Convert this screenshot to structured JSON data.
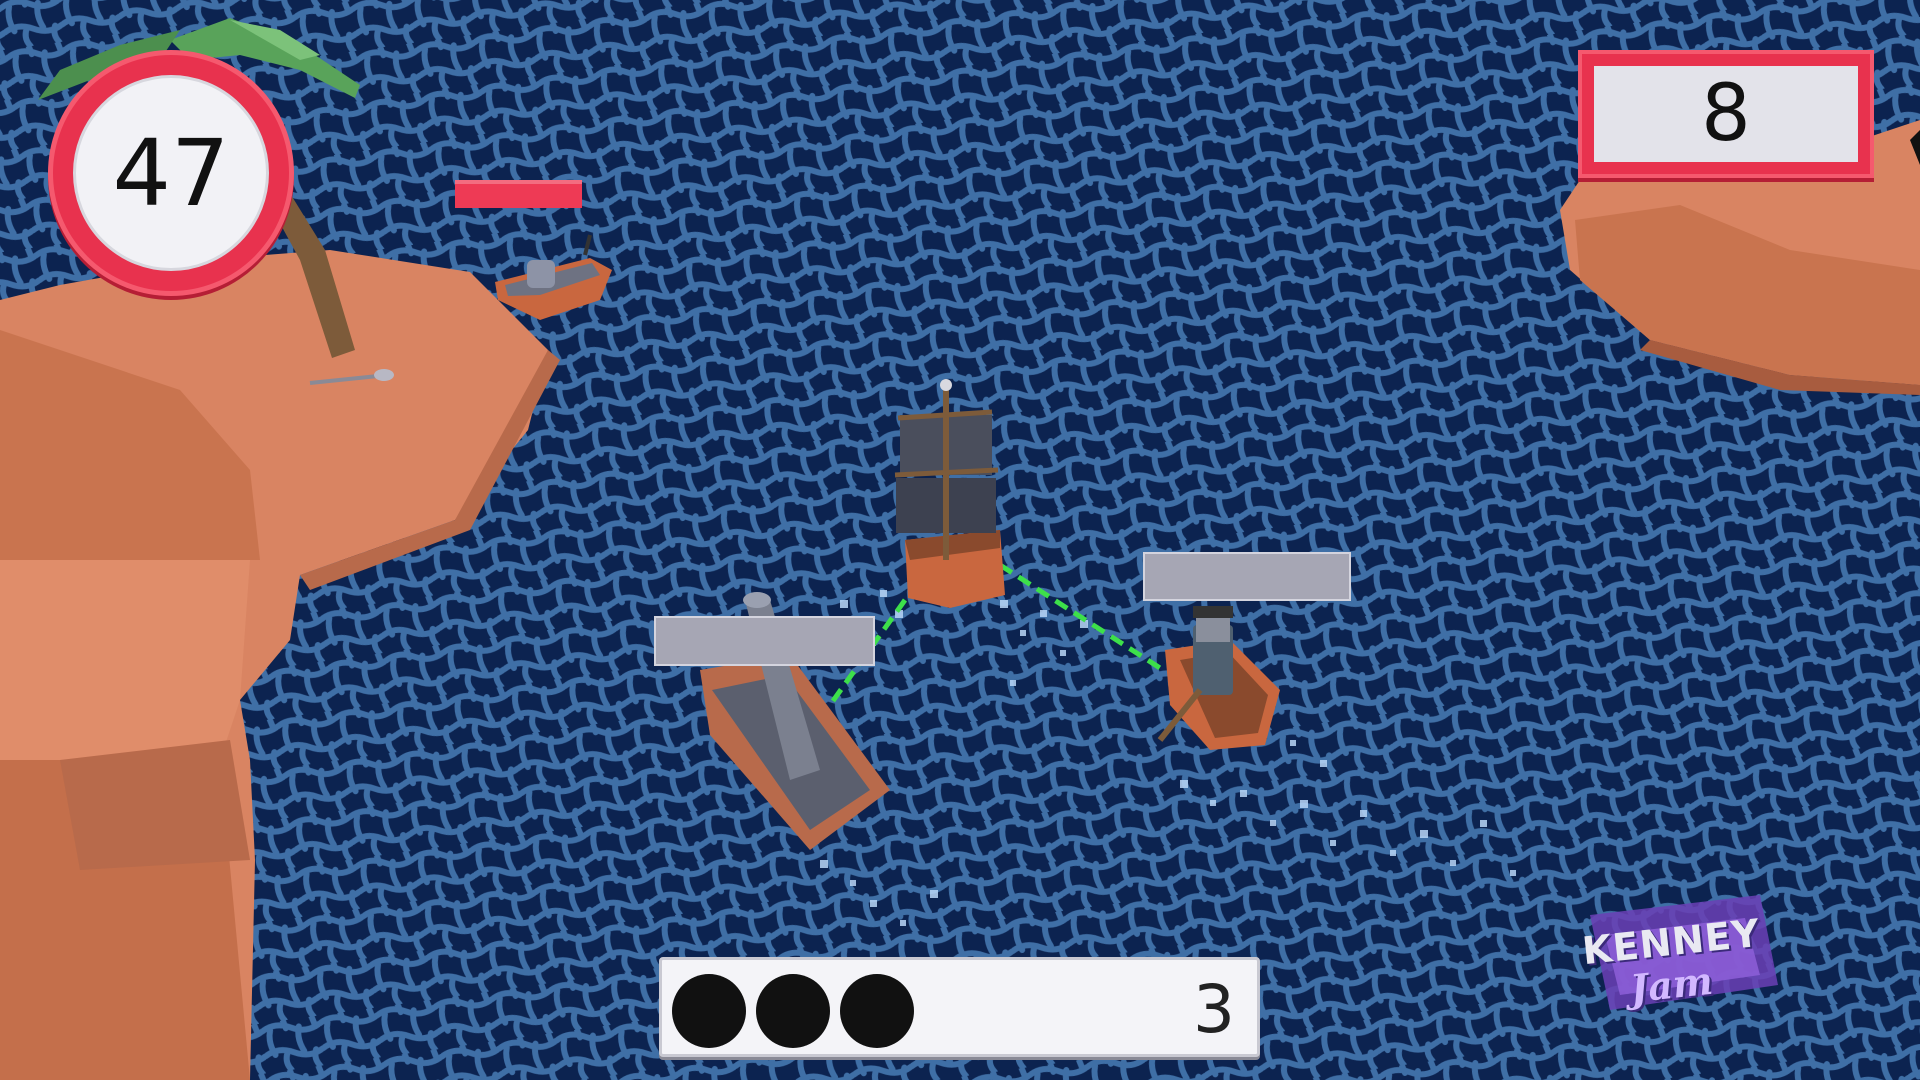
{
  "hud": {
    "timer_value": "47",
    "score_value": "8",
    "ammo_count": "3",
    "ammo_dots": 3
  },
  "enemy_health": [
    {
      "id": "skiff-north",
      "fraction": 1.0,
      "color": "#ee3a55"
    },
    {
      "id": "cannon-raft",
      "fraction": 0.0,
      "color": "#a6a6b4"
    },
    {
      "id": "rowboat-pirate",
      "fraction": 0.0,
      "color": "#a6a6b4"
    }
  ],
  "logo": {
    "line1": "KENNEY",
    "line2": "Jam"
  },
  "colors": {
    "water_dark": "#0c2350",
    "water_light": "#3f6fa6",
    "sand": "#d98462",
    "sand_shadow": "#b86a4b",
    "hud_red": "#e8324e",
    "hud_panel": "#e3e3ea",
    "tether": "#3de04a"
  },
  "icons": [
    "palm-tree-icon",
    "shovel-icon",
    "pirate-ship-icon",
    "cannon-raft-icon",
    "rowboat-icon",
    "skiff-icon",
    "cannonball-icon"
  ]
}
